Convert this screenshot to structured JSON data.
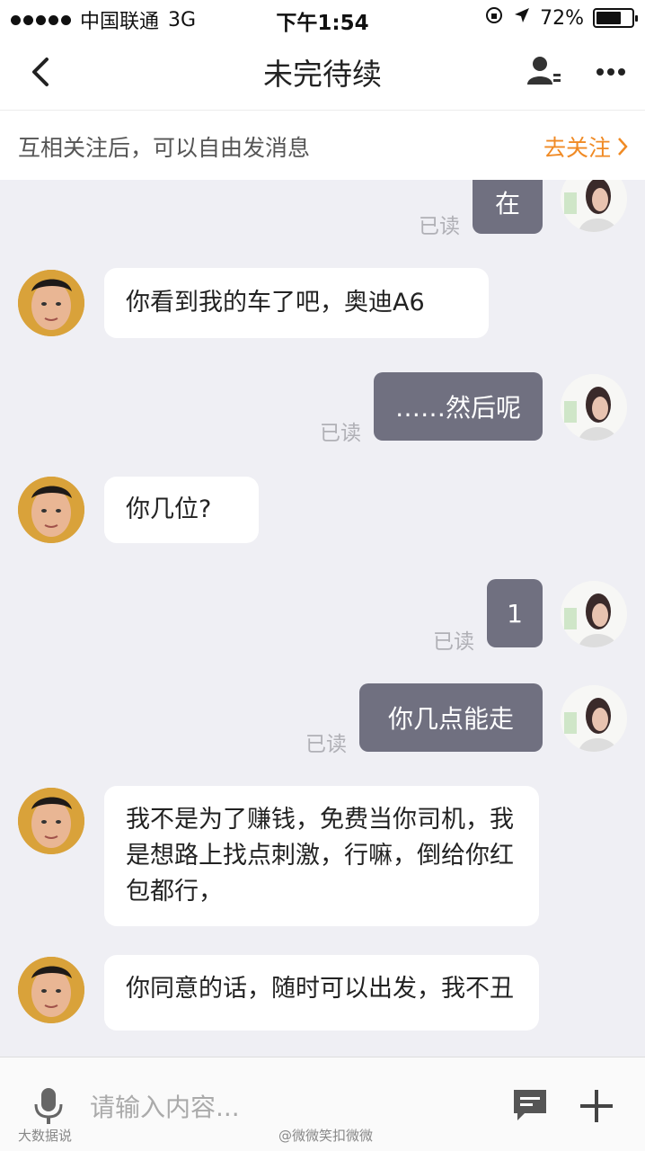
{
  "status": {
    "carrier": "中国联通",
    "network": "3G",
    "time": "下午1:54",
    "battery": "72%",
    "battery_level": 0.72
  },
  "nav": {
    "title": "未完待续",
    "back_icon": "chevron-left-icon",
    "profile_icon": "person-list-icon",
    "more_icon": "more-dots-icon"
  },
  "follow": {
    "hint": "互相关注后，可以自由发消息",
    "action": "去关注"
  },
  "messages": [
    {
      "from": "me",
      "text": "在",
      "status": "已读"
    },
    {
      "from": "them",
      "text": "你看到我的车了吧，奥迪A6"
    },
    {
      "from": "me",
      "text": "……然后呢",
      "status": "已读"
    },
    {
      "from": "them",
      "text": "你几位?"
    },
    {
      "from": "me",
      "text": "1",
      "status": "已读"
    },
    {
      "from": "me",
      "text": "你几点能走",
      "status": "已读"
    },
    {
      "from": "them",
      "text": "我不是为了赚钱，免费当你司机，我是想路上找点刺激，行嘛，倒给你红包都行，"
    },
    {
      "from": "them",
      "text": "你同意的话，随时可以出发，我不丑"
    }
  ],
  "input": {
    "placeholder": "请输入内容...",
    "mic_icon": "microphone-icon",
    "emoji_icon": "chat-bubble-icon",
    "plus_icon": "plus-icon"
  },
  "colors": {
    "outgoing_bubble": "#707080",
    "incoming_bubble": "#ffffff",
    "accent": "#f08a24",
    "background": "#efeff4"
  },
  "watermarks": [
    "大数据说",
    "@微微笑扣微微"
  ]
}
